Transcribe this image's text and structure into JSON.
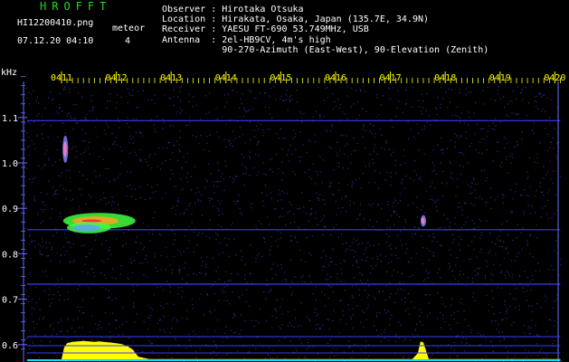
{
  "header": {
    "app_title": "HROFFT",
    "filename": "HI12200410.png",
    "meteor_label": "meteor",
    "timestamp": "07.12.20 04:10",
    "meteor_count": "4"
  },
  "info": [
    {
      "label": "Observer",
      "value": "Hirotaka Otsuka"
    },
    {
      "label": "Location",
      "value": "Hirakata, Osaka, Japan (135.7E, 34.9N)"
    },
    {
      "label": "Receiver",
      "value": "YAESU FT-690 53.749MHz, USB"
    },
    {
      "label": "Antenna ",
      "value": "2el-HB9CV, 4m's high"
    },
    {
      "label": "",
      "value": "90-270-Azimuth (East-West), 90-Elevation (Zenith)"
    }
  ],
  "colors": {
    "background": "#000000",
    "tick_text": "#ffff00",
    "axis": "#6a6aff",
    "hline": "#3a3aff",
    "meteor_hot": "#ff2040",
    "meteor_warm": "#40ff40",
    "power_fill": "#ffff00",
    "power_base": "#00e0ff",
    "title": "#18e018"
  },
  "chart_data": {
    "type": "heatmap",
    "title": "",
    "xlabel": "",
    "ylabel": "kHz",
    "x_ticks": [
      "0411",
      "0412",
      "0413",
      "0414",
      "0415",
      "0416",
      "0417",
      "0418",
      "0419",
      "0420"
    ],
    "x_tick_values": [
      0,
      1,
      2,
      3,
      4,
      5,
      6,
      7,
      8,
      9
    ],
    "xlim": [
      0,
      9.1
    ],
    "y_ticks": [
      "1.1",
      "1.0",
      "0.9",
      "0.8",
      "0.7",
      "0.6"
    ],
    "y_tick_values": [
      1.1,
      1.0,
      0.9,
      0.8,
      0.7,
      0.6
    ],
    "ylim": [
      0.59,
      1.2
    ],
    "carrier_lines_khz": [
      1.093,
      0.853,
      0.733
    ],
    "meteor_echoes": [
      {
        "t_start": 0.03,
        "t_end": 1.35,
        "f_low": 0.855,
        "f_high": 0.89,
        "strength": "strong"
      },
      {
        "t_start": 0.1,
        "t_end": 0.9,
        "f_low": 0.845,
        "f_high": 0.87,
        "strength": "medium"
      },
      {
        "t_start": 6.55,
        "t_end": 6.65,
        "f_low": 0.86,
        "f_high": 0.885,
        "strength": "weak"
      },
      {
        "t_start": 0.02,
        "t_end": 0.12,
        "f_low": 1.0,
        "f_high": 1.06,
        "strength": "weak"
      }
    ],
    "power_profile": {
      "t": [
        0.0,
        0.05,
        0.1,
        0.2,
        0.3,
        0.4,
        0.5,
        0.6,
        0.7,
        0.8,
        0.9,
        1.0,
        1.1,
        1.2,
        1.3,
        1.4,
        1.6,
        6.4,
        6.5,
        6.55,
        6.6,
        6.65,
        6.7,
        9.1
      ],
      "level": [
        0.05,
        0.55,
        0.72,
        0.78,
        0.8,
        0.82,
        0.8,
        0.78,
        0.8,
        0.77,
        0.75,
        0.72,
        0.68,
        0.6,
        0.45,
        0.15,
        0.05,
        0.05,
        0.3,
        0.8,
        0.75,
        0.4,
        0.05,
        0.05
      ]
    }
  }
}
